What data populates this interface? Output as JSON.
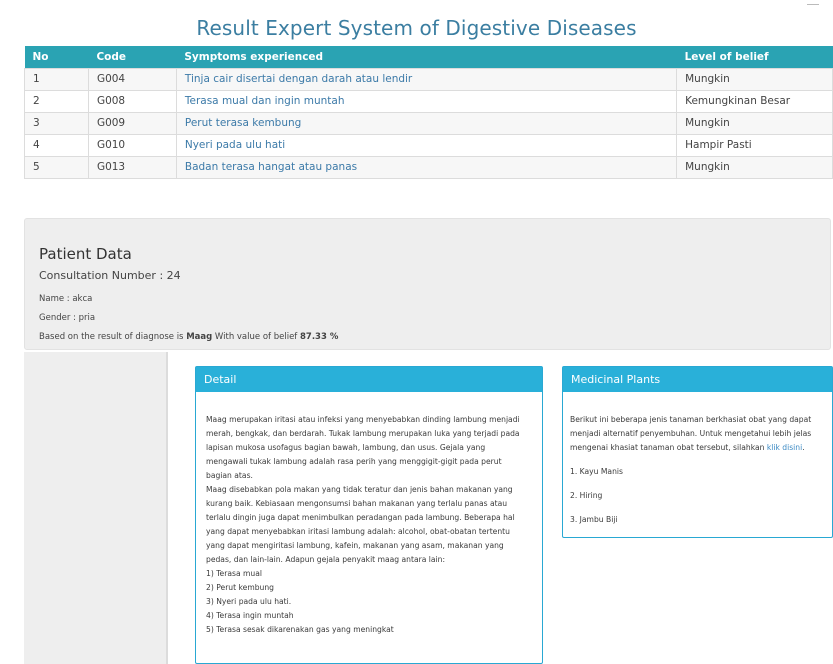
{
  "page": {
    "title": "Result Expert System of Digestive Diseases"
  },
  "table": {
    "headers": [
      "No",
      "Code",
      "Symptoms experienced",
      "Level of belief"
    ],
    "rows": [
      {
        "no": "1",
        "code": "G004",
        "symptom": "Tinja cair disertai dengan darah atau lendir",
        "level": "Mungkin"
      },
      {
        "no": "2",
        "code": "G008",
        "symptom": "Terasa mual dan ingin muntah",
        "level": "Kemungkinan Besar"
      },
      {
        "no": "3",
        "code": "G009",
        "symptom": "Perut terasa kembung",
        "level": "Mungkin"
      },
      {
        "no": "4",
        "code": "G010",
        "symptom": "Nyeri pada ulu hati",
        "level": "Hampir Pasti"
      },
      {
        "no": "5",
        "code": "G013",
        "symptom": "Badan terasa hangat atau panas",
        "level": "Mungkin"
      }
    ]
  },
  "patient": {
    "title": "Patient Data",
    "consultation": "Consultation Number : 24",
    "name": "Name : akca",
    "gender": "Gender : pria",
    "diagnose_prefix": "Based on the result of diagnose is ",
    "disease": "Maag",
    "belief_prefix": " With value of belief ",
    "belief_value": "87.33 %"
  },
  "detail": {
    "title": "Detail",
    "lines": [
      "Maag merupakan iritasi atau infeksi yang menyebabkan dinding lambung menjadi",
      "merah, bengkak, dan berdarah. Tukak lambung merupakan luka yang terjadi pada",
      "lapisan mukosa usofagus bagian bawah, lambung, dan usus. Gejala yang",
      "mengawali tukak lambung adalah rasa perih yang menggigit-gigit pada perut",
      "bagian atas.",
      "Maag disebabkan pola makan yang tidak teratur dan jenis bahan makanan yang",
      "kurang baik. Kebiasaan mengonsumsi bahan makanan yang terlalu panas atau",
      "terlalu dingin juga dapat menimbulkan peradangan pada lambung. Beberapa hal",
      "yang dapat menyebabkan iritasi lambung adalah: alcohol, obat-obatan tertentu",
      "yang dapat mengiritasi lambung, kafein, makanan yang asam, makanan yang",
      "pedas, dan lain-lain. Adapun gejala penyakit maag antara lain:",
      "1) Terasa mual",
      "2) Perut kembung",
      "3) Nyeri pada ulu hati.",
      "4) Terasa ingin muntah",
      "5) Terasa sesak dikarenakan gas yang meningkat"
    ]
  },
  "plants": {
    "title": "Medicinal Plants",
    "intro_lines": [
      "Berikut ini beberapa jenis tanaman berkhasiat obat yang dapat",
      "menjadi alternatif penyembuhan. Untuk mengetahui lebih jelas"
    ],
    "intro_last": "mengenai khasiat tanaman obat tersebut, silahkan ",
    "link": "klik disini",
    "link_suffix": ".",
    "items": [
      "1. Kayu Manis",
      "2. Hiring",
      "3. Jambu Biji"
    ]
  }
}
